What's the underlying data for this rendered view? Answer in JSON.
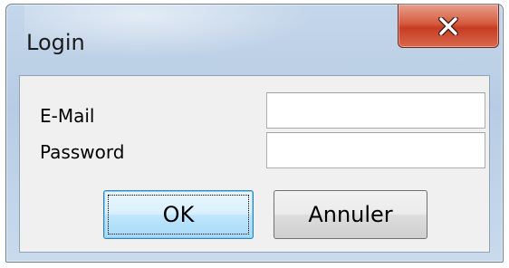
{
  "window": {
    "title": "Login",
    "close_icon": "close-x-icon"
  },
  "form": {
    "email_label": "E-Mail",
    "email_value": "",
    "password_label": "Password",
    "password_value": ""
  },
  "buttons": {
    "ok_label": "OK",
    "cancel_label": "Annuler"
  },
  "colors": {
    "close_button": "#c63c23",
    "ok_button_focus": "#3c7fb1",
    "client_background": "#f0f0f0"
  }
}
